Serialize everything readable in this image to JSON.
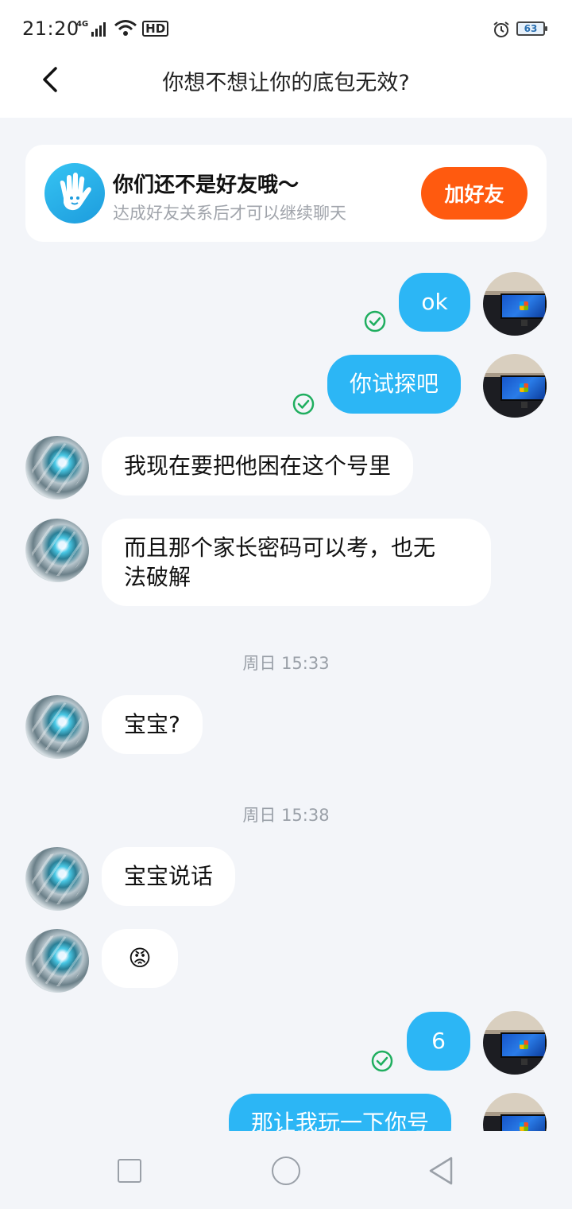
{
  "status_bar": {
    "time": "21:20",
    "network": "4G",
    "hd_label": "HD",
    "battery_level": "63",
    "icons": [
      "signal-icon",
      "wifi-icon",
      "hd-icon",
      "alarm-icon",
      "battery-icon"
    ]
  },
  "nav": {
    "title": "你想不想让你的底包无效?",
    "back_icon": "chevron-left-icon"
  },
  "friend_card": {
    "title": "你们还不是好友哦～",
    "subtitle": "达成好友关系后才可以继续聊天",
    "button": "加好友",
    "icon": "hand-wave-icon",
    "button_color": "#ff5a0f"
  },
  "messages": {
    "m1": "ok",
    "m2": "你试探吧",
    "m3": "我现在要把他困在这个号里",
    "m4_line1": "而且那个家长密码可以考，也无",
    "m4_line2": "法破解",
    "t1": "周日 15:33",
    "m5": "宝宝?",
    "t2": "周日 15:38",
    "m6": "宝宝说话",
    "m7": "😡",
    "m8": "6",
    "m9": "那让我玩一下你号"
  },
  "colors": {
    "outgoing_bubble": "#2cb6f5",
    "incoming_bubble": "#ffffff",
    "read_check": "#1fae5f",
    "background": "#f3f5f9"
  },
  "bottom_nav": {
    "icons": [
      "recent-apps-icon",
      "home-icon",
      "back-triangle-icon"
    ]
  }
}
